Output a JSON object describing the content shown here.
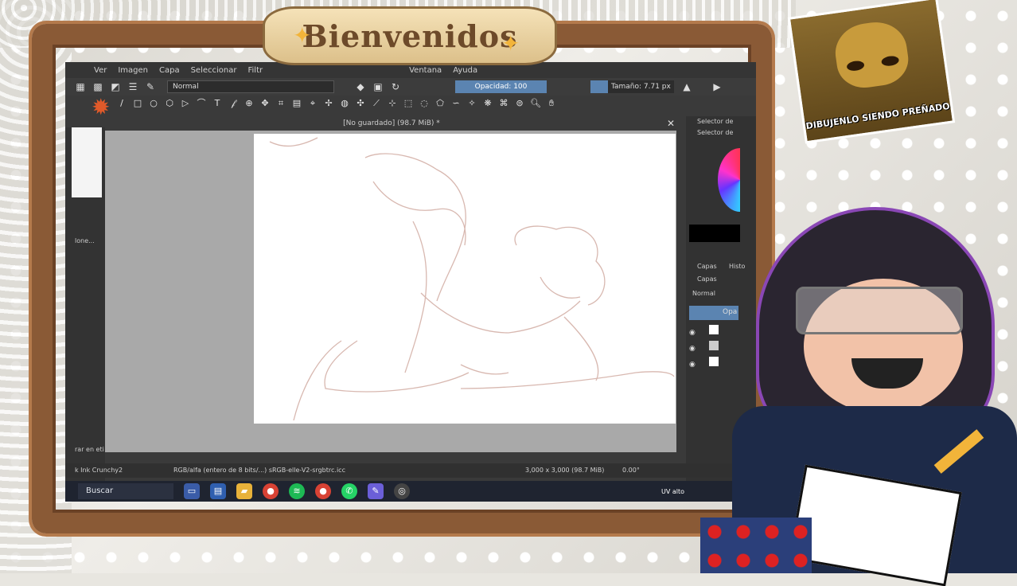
{
  "overlay": {
    "banner_title": "Bienvenidos",
    "meme_caption": "DIBUJENLO SIENDO PREÑADO"
  },
  "app": {
    "menus": [
      "Ver",
      "Imagen",
      "Capa",
      "Seleccionar",
      "Filtr",
      "Ventana",
      "Ayuda"
    ],
    "blend_mode": "Normal",
    "opacity_label": "Opacidad: 100",
    "size_label": "Tamaño: 7.71 px",
    "document_title": "[No guardado] (98.7 MiB) *",
    "docker_label_1": "Selector de",
    "docker_label_2": "Selector de",
    "layers_tab": "Capas",
    "history_tab": "Histo",
    "layers_header": "Capas",
    "layer_blend": "Normal",
    "layer_opacity": "Opa",
    "left_dock_label_1": "lone...",
    "left_dock_label_2": "rar en eti",
    "status_brush": "k Ink Crunchy2",
    "status_color": "RGB/alfa (entero de 8 bits/...)  sRGB-elle-V2-srgbtrc.icc",
    "status_size": "3,000 x 3,000 (98.7 MiB)",
    "status_rotation": "0.00°"
  },
  "taskbar": {
    "search_placeholder": "Buscar",
    "tray_text": "UV alto",
    "icons": [
      "explorer-icon",
      "store-icon",
      "folder-icon",
      "chrome-icon",
      "spotify-icon",
      "chrome2-icon",
      "whatsapp-icon",
      "krita-icon",
      "obs-icon"
    ]
  },
  "colors": {
    "accent": "#5b84b1",
    "wood": "#8a5a36",
    "banner": "#f5e2b8"
  }
}
